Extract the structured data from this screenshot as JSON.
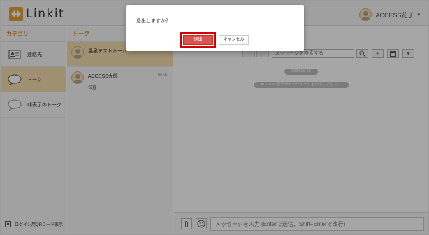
{
  "app": {
    "logo_text": "Linkit",
    "user_name": "ACCESS花子",
    "accent_color": "#d98a1a",
    "highlight_color": "#f6ddb0"
  },
  "categories": {
    "heading": "カテゴリ",
    "items": [
      {
        "label": "連絡先",
        "icon": "contact-card-icon"
      },
      {
        "label": "トーク",
        "icon": "speech-bubble-icon"
      },
      {
        "label": "非表示のトーク",
        "icon": "hidden-speech-bubble-icon"
      }
    ],
    "footer_label": "ログイン用QRコード表示"
  },
  "talks": {
    "heading": "トーク",
    "items": [
      {
        "name": "温泉テストルーム",
        "subtitle": "",
        "date": ""
      },
      {
        "name": "ACCESS太郎",
        "subtitle": "位置",
        "date": "06/16"
      }
    ]
  },
  "chat": {
    "search_placeholder": "メッセージを検索する",
    "date_chip": "2024.06.26",
    "system_message": "ACCESS花子がトークルームを作成しました。",
    "input_placeholder": "メッセージを入力 (Enterで送信、Shift+Enterで改行)"
  },
  "dialog": {
    "message": "退出しますか？",
    "confirm_label": "退出",
    "cancel_label": "キャンセル",
    "confirm_color": "#d9534f",
    "highlight_outline_color": "#d00000"
  }
}
